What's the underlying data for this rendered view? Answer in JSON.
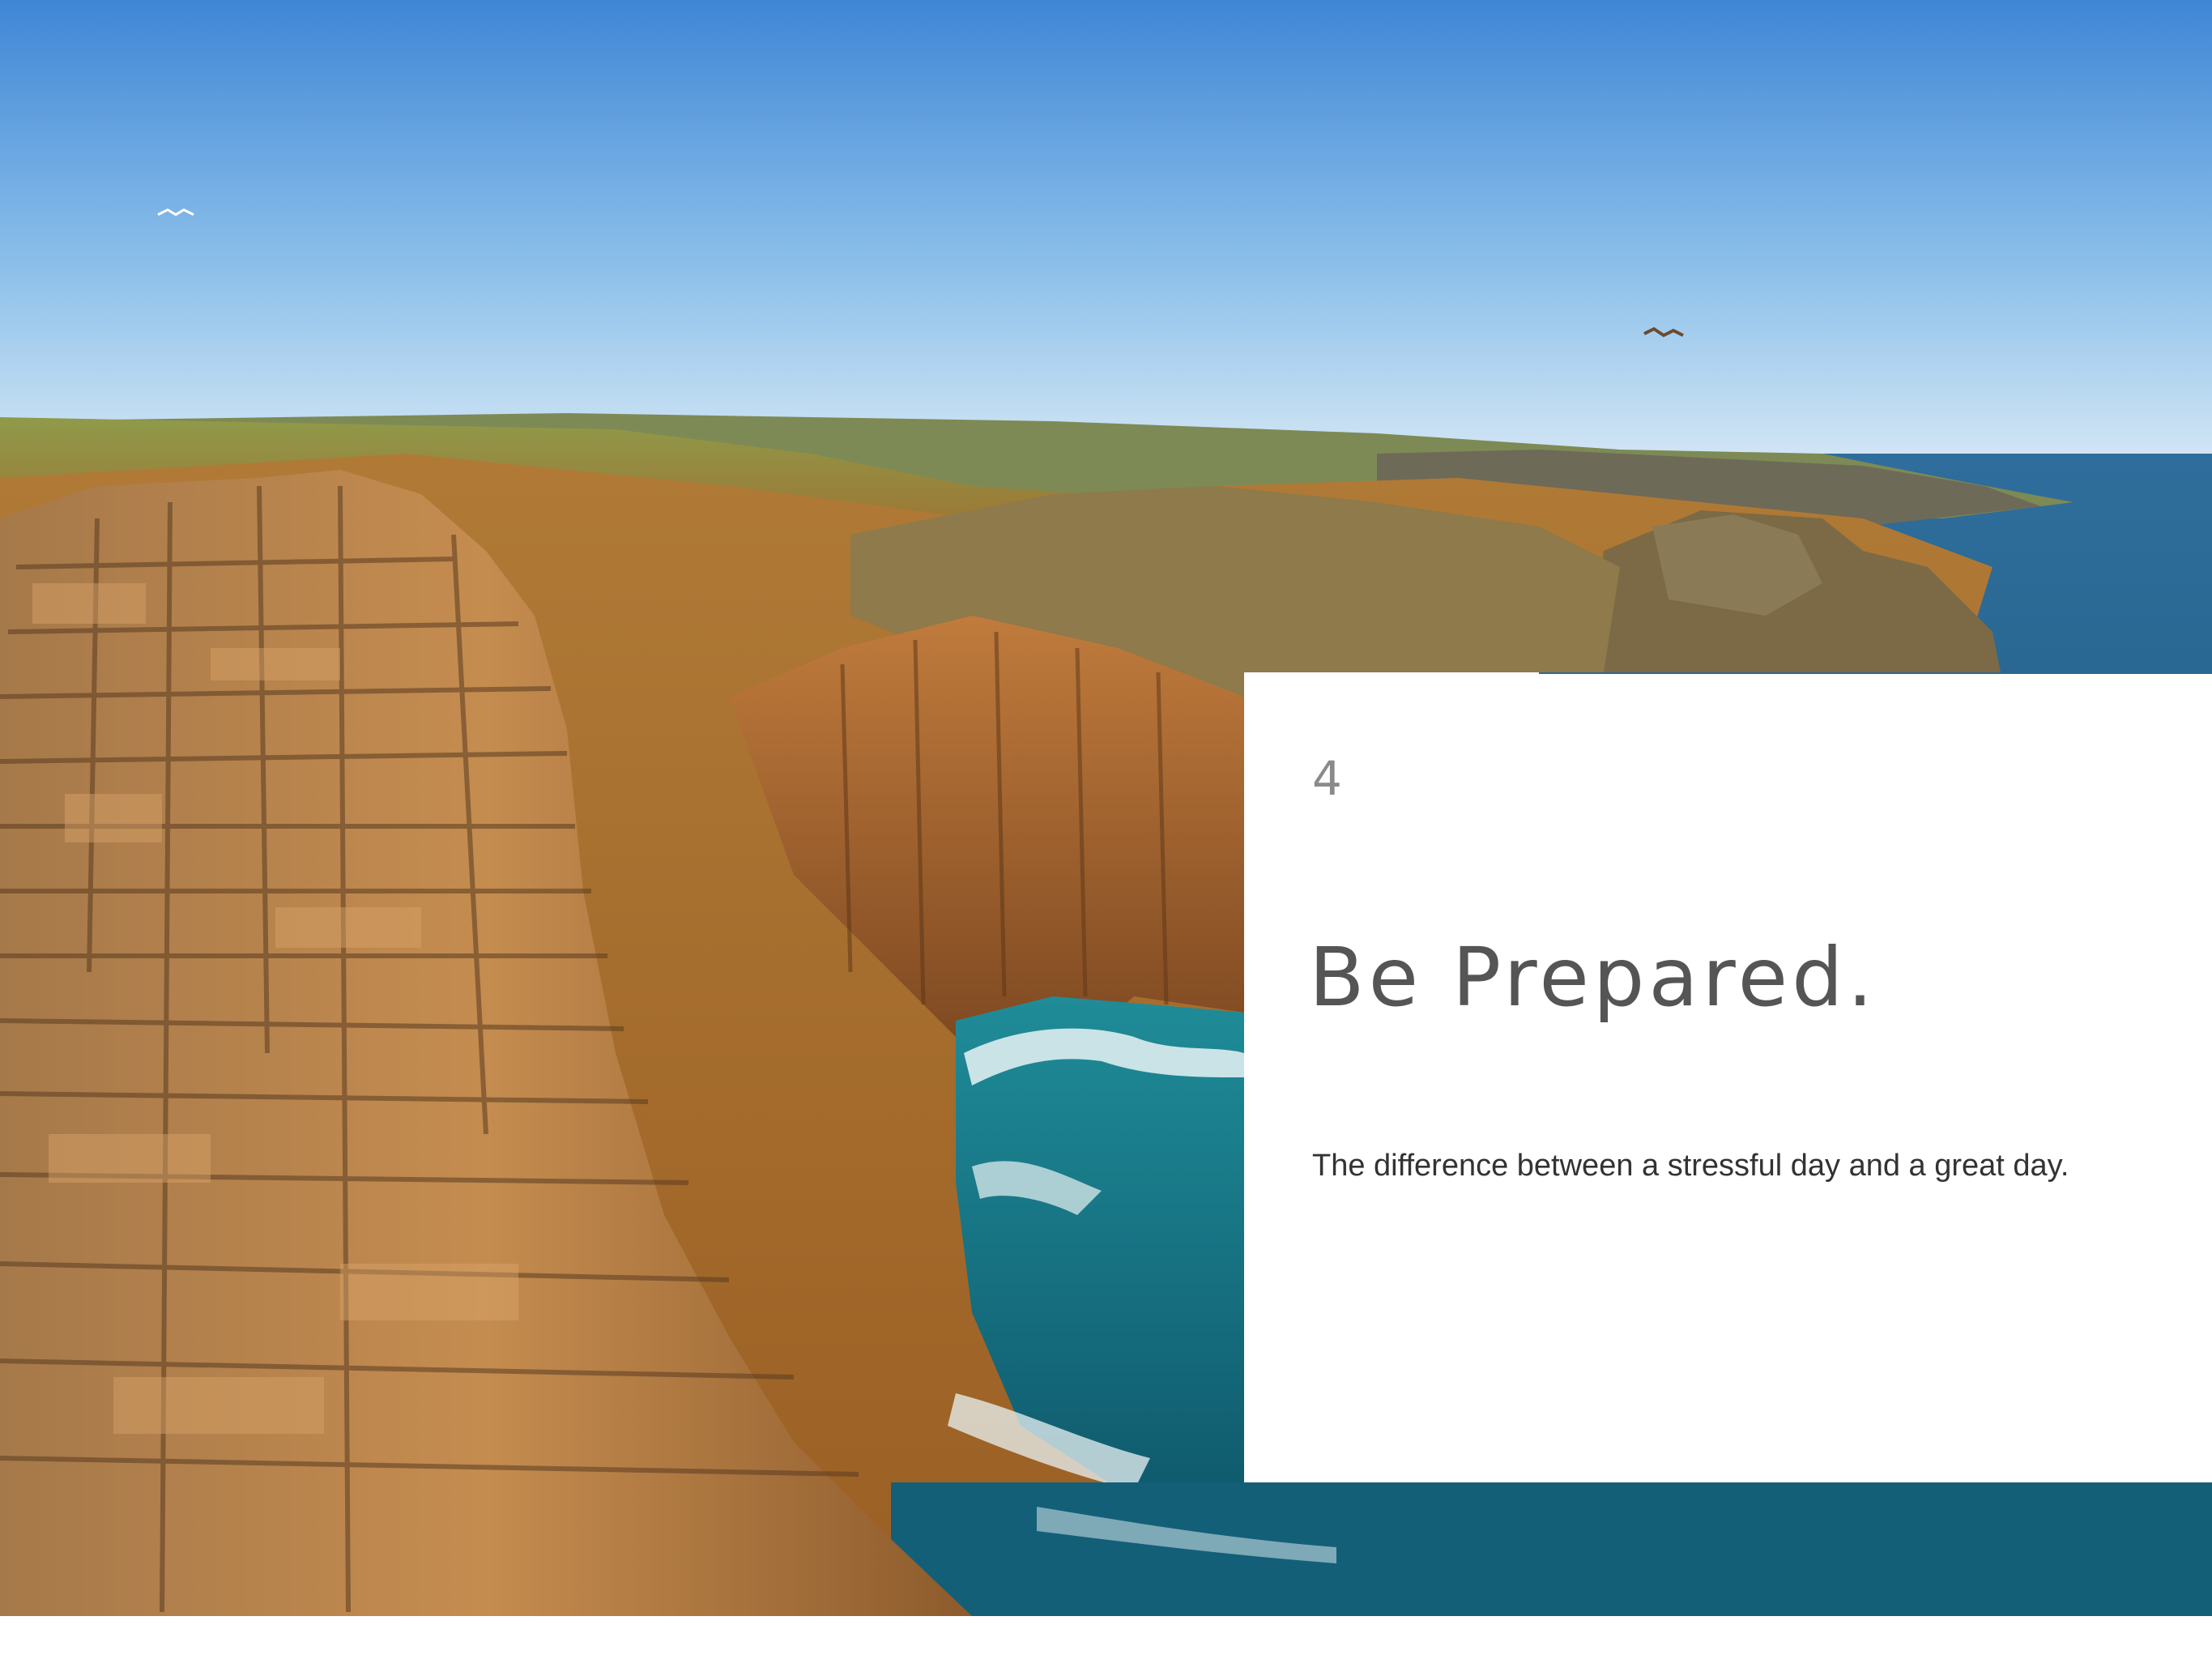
{
  "slide": {
    "number": "4",
    "title": "Be Prepared.",
    "body": "The difference between a stressful day and a great day."
  },
  "photo": {
    "subject": "",
    "sky_color": "#4a90d9",
    "sea_color": "#1d6a86",
    "rock_color": "#b77a3d"
  }
}
